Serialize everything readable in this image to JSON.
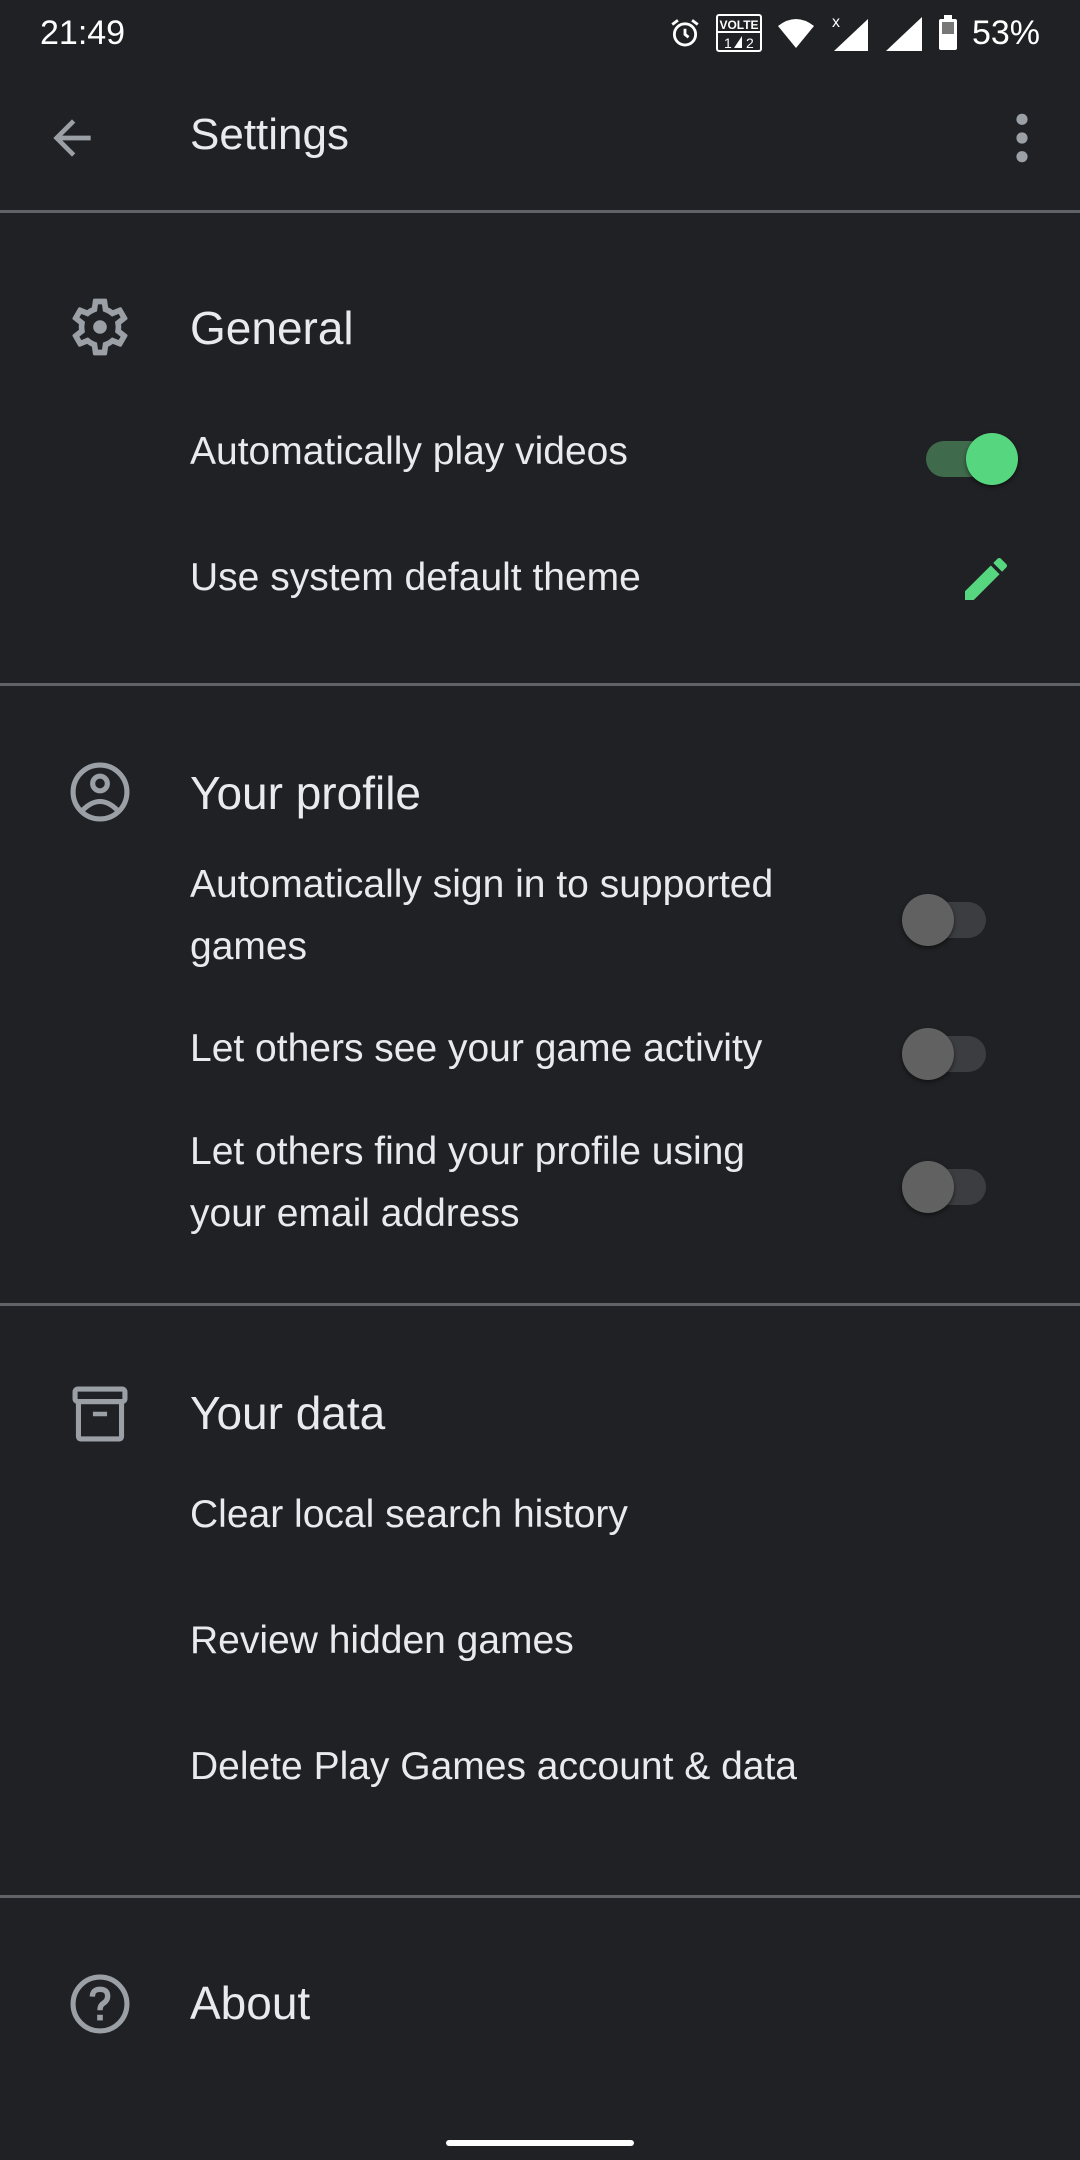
{
  "status_bar": {
    "time": "21:49",
    "icons": [
      "alarm-icon",
      "volte-icon",
      "wifi-icon",
      "signal-no-data-icon",
      "signal-icon",
      "battery-icon"
    ],
    "volte_label": "VOLTE",
    "battery_percent": "53%"
  },
  "app_bar": {
    "back_icon": "arrow-left-icon",
    "title": "Settings",
    "more_icon": "more-vert-icon"
  },
  "sections": {
    "general": {
      "icon": "gear-icon",
      "title": "General",
      "items": [
        {
          "label": "Automatically play videos",
          "control": "toggle",
          "checked": true
        },
        {
          "label": "Use system default theme",
          "control": "edit",
          "icon": "pencil-icon"
        }
      ]
    },
    "profile": {
      "icon": "account-circle-icon",
      "title": "Your profile",
      "items": [
        {
          "label": "Automatically sign in to supported games",
          "control": "toggle",
          "checked": false
        },
        {
          "label": "Let others see your game activity",
          "control": "toggle",
          "checked": false
        },
        {
          "label": "Let others find your profile using your email address",
          "control": "toggle",
          "checked": false
        }
      ]
    },
    "data": {
      "icon": "archive-box-icon",
      "title": "Your data",
      "items": [
        {
          "label": "Clear local search history"
        },
        {
          "label": "Review hidden games"
        },
        {
          "label": "Delete Play Games account & data"
        }
      ]
    },
    "about": {
      "icon": "help-circle-icon",
      "title": "About"
    }
  },
  "colors": {
    "background": "#202124",
    "text": "#e8eaed",
    "icon": "#9aa0a6",
    "accent": "#57d680",
    "divider": "#5f6368"
  }
}
